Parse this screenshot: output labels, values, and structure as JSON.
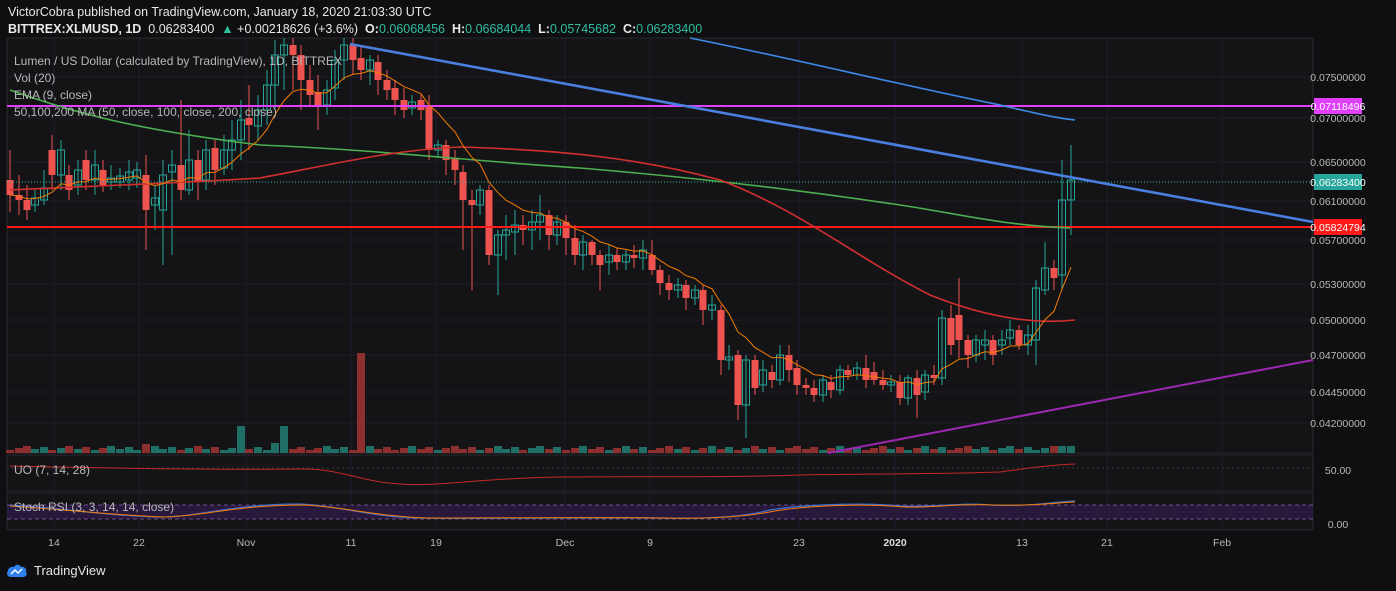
{
  "header": {
    "publisher": "VictorCobra published on TradingView.com, January 18, 2020 21:03:30 UTC",
    "symbol": "BITTREX:XLMUSD, 1D",
    "last": "0.06283400",
    "change": "+0.00218626 (+3.6%)",
    "o_label": "O:",
    "open": "0.06068456",
    "h_label": "H:",
    "high": "0.06684044",
    "l_label": "L:",
    "low": "0.05745682",
    "c_label": "C:",
    "close": "0.06283400"
  },
  "overlays": {
    "title": "Lumen / US Dollar (calculated by TradingView), 1D, BITTREX",
    "vol": "Vol (20)",
    "ema": "EMA (9, close)",
    "ma": "50,100,200 MA (50, close, 100, close, 200, close)"
  },
  "uo_label": "UO (7, 14, 28)",
  "stoch_label": "Stoch RSI (3, 3, 14, 14, close)",
  "price_axis": [
    "0.07500000",
    "0.07000000",
    "0.06500000",
    "0.06100000",
    "0.05700000",
    "0.05300000",
    "0.05000000",
    "0.04700000",
    "0.04450000",
    "0.04200000"
  ],
  "price_marks": {
    "magenta": "0.07118496",
    "current": "0.06283400",
    "red": "0.05824794"
  },
  "uo_axis": [
    "50.00"
  ],
  "stoch_axis": [
    "0.00"
  ],
  "time_axis": [
    "14",
    "22",
    "Nov",
    "11",
    "19",
    "Dec",
    "9",
    "23",
    "2020",
    "13",
    "21",
    "Feb"
  ],
  "colors": {
    "up": "#26a69a",
    "down": "#ef5350",
    "magenta": "#e040fb",
    "red": "#ff1a1a",
    "blue": "#4a7fe0",
    "green": "#4caf50",
    "ma_red": "#d32f2f",
    "ema": "#f57c00",
    "purple": "#9c27b0"
  },
  "branding": {
    "logo_text": "TradingView",
    "icon": "tradingview-cloud-icon"
  }
}
